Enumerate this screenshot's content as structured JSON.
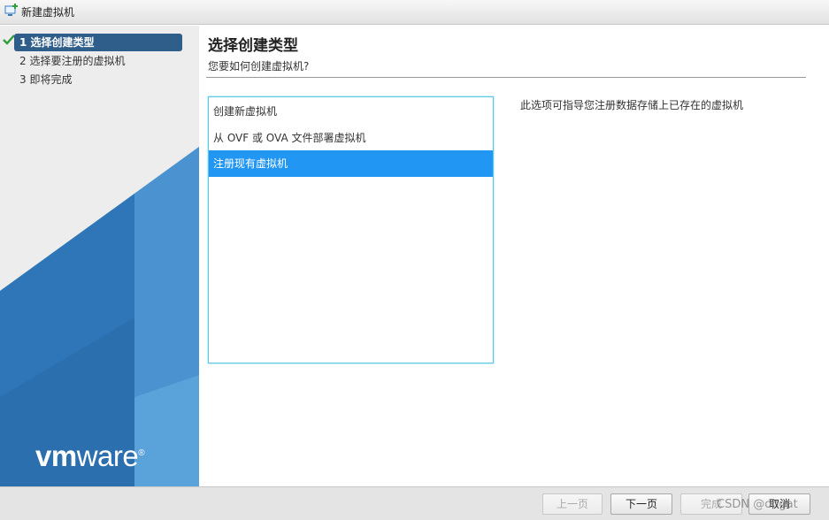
{
  "window": {
    "title": "新建虚拟机",
    "icon": "new-vm-icon"
  },
  "sidebar": {
    "steps": [
      {
        "label": "1 选择创建类型",
        "active": true,
        "completed": true
      },
      {
        "label": "2 选择要注册的虚拟机",
        "active": false
      },
      {
        "label": "3 即将完成",
        "active": false
      }
    ],
    "logo": {
      "vm": "vm",
      "ware": "ware",
      "mark": "®"
    }
  },
  "main": {
    "title": "选择创建类型",
    "subtitle": "您要如何创建虚拟机?",
    "options": [
      {
        "label": "创建新虚拟机",
        "selected": false
      },
      {
        "label": "从 OVF 或 OVA 文件部署虚拟机",
        "selected": false
      },
      {
        "label": "注册现有虚拟机",
        "selected": true
      }
    ],
    "description": "此选项可指导您注册数据存储上已存在的虚拟机"
  },
  "footer": {
    "back": "上一页",
    "next": "下一页",
    "finish": "完成",
    "cancel": "取消"
  },
  "watermark": "CSDN @ongat",
  "colors": {
    "accent": "#2196f3",
    "active_step": "#2f5e8a",
    "list_border": "#5bc7e6"
  }
}
